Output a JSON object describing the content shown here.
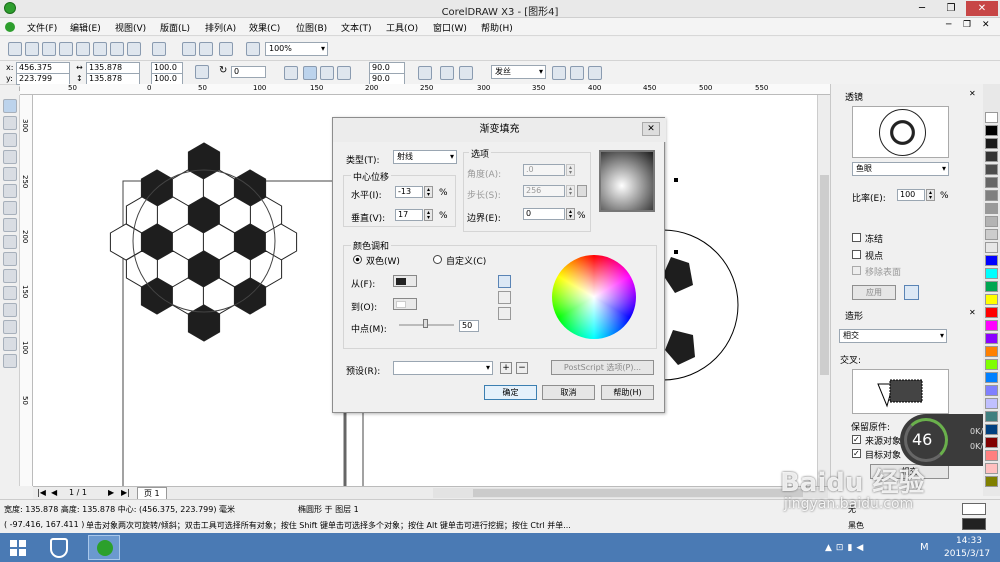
{
  "window": {
    "title": "CorelDRAW X3 - [图形4]"
  },
  "menu": [
    "文件(F)",
    "编辑(E)",
    "视图(V)",
    "版面(L)",
    "排列(A)",
    "效果(C)",
    "位图(B)",
    "文本(T)",
    "工具(O)",
    "窗口(W)",
    "帮助(H)"
  ],
  "toolbar": {
    "zoom": "100%"
  },
  "propbar": {
    "x": "456.375 mm",
    "y": "223.799 mm",
    "w": "135.878 mm",
    "h": "135.878 mm",
    "sx": "100.0",
    "sy": "100.0",
    "angle": "0",
    "a1": "90.0",
    "a2": "90.0",
    "outline": "发丝"
  },
  "ruler": {
    "h": [
      "50",
      "0",
      "50",
      "100",
      "150",
      "200",
      "250",
      "300",
      "350",
      "400",
      "450",
      "500",
      "550"
    ],
    "v": [
      "300",
      "250",
      "200",
      "150",
      "100",
      "50"
    ]
  },
  "dialog": {
    "title": "渐变填充",
    "type_label": "类型(T):",
    "type_value": "射线",
    "options_label": "选项",
    "center_label": "中心位移",
    "horiz_label": "水平(I):",
    "horiz_value": "-13",
    "vert_label": "垂直(V):",
    "vert_value": "17",
    "percent": "%",
    "angle_label": "角度(A):",
    "angle_value": ".0",
    "steps_label": "步长(S):",
    "steps_value": "256",
    "edge_label": "边界(E):",
    "edge_value": "0",
    "blend_label": "颜色调和",
    "two_color": "双色(W)",
    "custom": "自定义(C)",
    "from_label": "从(F):",
    "to_label": "到(O):",
    "mid_label": "中点(M):",
    "mid_value": "50",
    "preset_label": "预设(R):",
    "postscript": "PostScript 选项(P)...",
    "ok": "确定",
    "cancel": "取消",
    "help": "帮助(H)"
  },
  "docker_lens": {
    "title": "透镜",
    "lens_type": "鱼眼",
    "rate_label": "比率(E):",
    "rate_value": "100",
    "percent": "%",
    "freeze": "冻结",
    "viewpoint": "视点",
    "remove_face": "移除表面",
    "apply": "应用"
  },
  "docker_shape": {
    "title": "造形",
    "mode": "相交",
    "sub": "交叉:",
    "keep": "保留原件:",
    "source": "来源对象",
    "target": "目标对象",
    "action": "相交"
  },
  "meter": {
    "percent": "46",
    "up": "0K/s",
    "down": "0K/s"
  },
  "pagebar": {
    "page_count": "1 / 1",
    "page_tab": "页 1"
  },
  "status": {
    "line1": "宽度: 135.878 高度: 135.878 中心: (456.375, 223.799) 毫米",
    "object": "椭圆形 于 图层 1",
    "coords": "( -97.416, 167.411 )",
    "hint": "单击对象两次可旋转/倾斜；双击工具可选择所有对象；按住 Shift 键单击可选择多个对象；按住 Alt 键单击可进行挖掘；按住 Ctrl 并单...",
    "fill_none": "无",
    "fill_black": "黑色"
  },
  "taskbar": {
    "time": "14:33",
    "date": "2015/3/17",
    "ime": "M"
  },
  "watermark": {
    "brand": "Baidu 经验",
    "url": "jingyan.baidu.com"
  },
  "colors": {
    "accent": "#4a7ab4",
    "ok_border": "#3c7fb1"
  },
  "palette": [
    "#ffffff",
    "#000000",
    "#1a1a1a",
    "#333333",
    "#4d4d4d",
    "#666666",
    "#808080",
    "#999999",
    "#b3b3b3",
    "#cccccc",
    "#e6e6e6",
    "#0000ff",
    "#00ffff",
    "#00a651",
    "#ffff00",
    "#ff0000",
    "#ff00ff",
    "#8b00ff",
    "#ff8000",
    "#80ff00",
    "#0080ff",
    "#8080ff",
    "#c0c0ff",
    "#408080",
    "#004080",
    "#800000",
    "#ff8080",
    "#ffc0c0",
    "#808000"
  ]
}
